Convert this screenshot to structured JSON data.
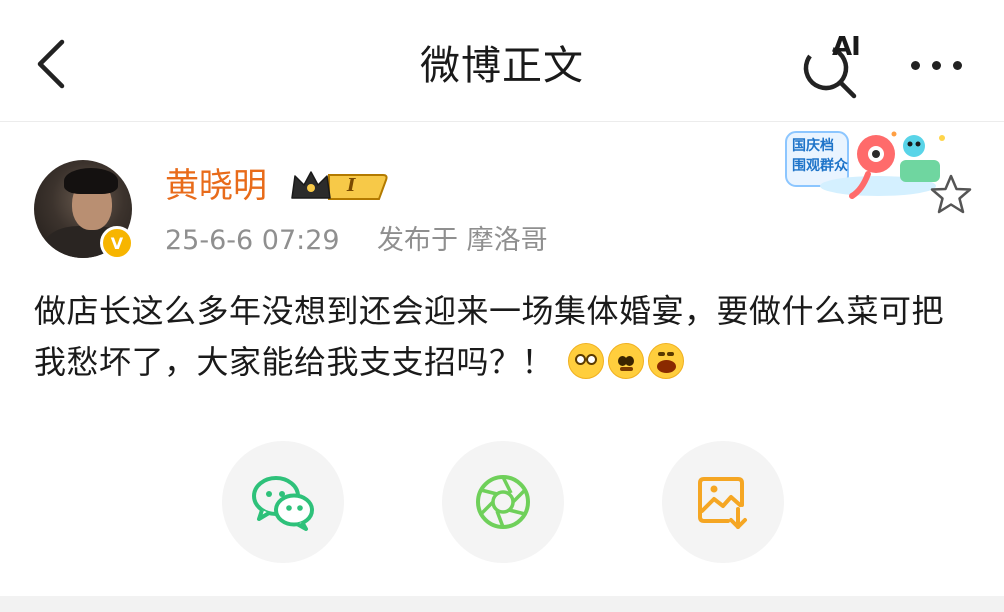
{
  "header": {
    "title": "微博正文",
    "ai_label": "AI"
  },
  "post": {
    "author": {
      "name": "黄晓明",
      "verified_mark": "V",
      "rank_label": "I"
    },
    "time": "25-6-6 07:29",
    "location": "发布于 摩洛哥",
    "text": "做店长这么多年没想到还会迎来一场集体婚宴，要做什么菜可把我愁坏了，大家能给我支支招吗？！",
    "emojis": [
      "glasses-emoji",
      "pleading-emoji",
      "crying-emoji"
    ]
  },
  "event_sticker": {
    "line1": "国庆档",
    "line2": "围观群众"
  },
  "share": {
    "items": [
      "wechat-icon",
      "moments-icon",
      "save-image-icon"
    ]
  },
  "colors": {
    "username": "#e86b1a",
    "meta": "#8f8f8f",
    "share_green": "#2ec17a",
    "share_lime": "#6fd05a",
    "share_orange": "#f5a623",
    "verified": "#f7b500"
  }
}
